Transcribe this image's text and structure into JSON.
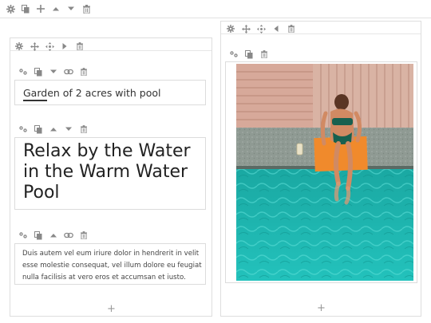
{
  "icons": {
    "gear": "gear-icon",
    "copy": "copy-icon",
    "add": "add-icon",
    "move": "move-icon",
    "link": "link-icon",
    "delete": "trash-icon",
    "up": "chevron-up-icon",
    "down": "chevron-down-icon",
    "right": "chevron-right-icon",
    "left": "chevron-left-icon"
  },
  "colors": {
    "border": "#dedede",
    "icon": "#888888",
    "pool": "#1fb5ae",
    "deck": "#d9b0a2",
    "towel": "#f08a2c"
  },
  "left_column": {
    "subtitle_widget": {
      "text": "Garden of 2 acres with pool"
    },
    "heading_widget": {
      "text": "Relax by the Water in the Warm Water Pool"
    },
    "paragraph_widget": {
      "text": "Duis autem vel eum iriure dolor in hendrerit in velit esse molestie consequat, vel illum dolore eu feugiat nulla facilisis at vero eros et accumsan et iusto."
    },
    "add_label": "+"
  },
  "right_column": {
    "add_label": "+"
  }
}
